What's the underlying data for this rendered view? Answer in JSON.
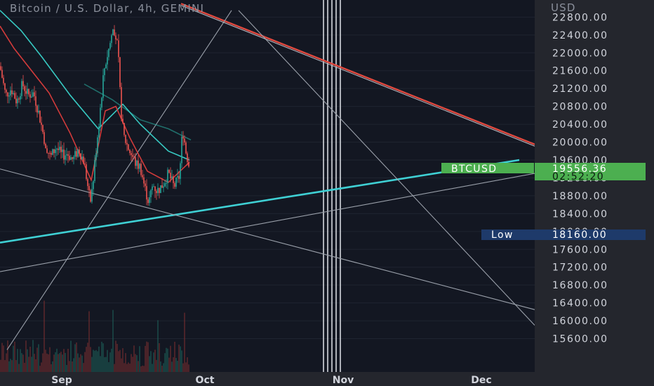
{
  "header": {
    "title": "Bitcoin / U.S. Dollar, 4h, GEMINI"
  },
  "axis": {
    "currency": "USD"
  },
  "colors": {
    "background": "#131722",
    "axis_bg": "#24262d",
    "grid": "#1f2430",
    "up": "#26a69a",
    "down": "#ef5350",
    "trend_red": "#e0493f",
    "trend_cyan": "#3fd0d4",
    "trend_grey": "#9aa0aa",
    "ma_slow": "#2aa89d",
    "ma_cyan": "#37c9c2",
    "ma_red": "#d33b3b",
    "tag_green": "#4caf50",
    "tag_navy": "#1e3a6a"
  },
  "tags": {
    "symbol": "BTCUSD",
    "last_price": "19556.36",
    "countdown": "02:52:20",
    "low_label": "Low",
    "low_value": "18160.00"
  },
  "chart_data": {
    "type": "candlestick",
    "title": "Bitcoin / U.S. Dollar, 4h, GEMINI",
    "y_label": "USD",
    "y_ticks": [
      15600,
      16000,
      16400,
      16800,
      17200,
      17600,
      18000,
      18400,
      18800,
      19200,
      19600,
      20000,
      20400,
      20800,
      21200,
      21600,
      22000,
      22400,
      22800
    ],
    "x_ticks": [
      "Sep",
      "Oct",
      "Nov",
      "Dec"
    ],
    "ylim": [
      15200,
      22900
    ],
    "last_price": 19556.36,
    "low": 18160.0,
    "grid": true,
    "series": [
      {
        "name": "",
        "kind": "price",
        "points": [
          [
            0,
            21700
          ],
          [
            8,
            21050
          ],
          [
            16,
            21200
          ],
          [
            24,
            20900
          ],
          [
            32,
            21300
          ],
          [
            40,
            21050
          ],
          [
            48,
            21100
          ],
          [
            56,
            20600
          ],
          [
            64,
            20000
          ],
          [
            72,
            19650
          ],
          [
            80,
            19900
          ],
          [
            88,
            19700
          ],
          [
            96,
            19750
          ],
          [
            104,
            19600
          ],
          [
            112,
            19850
          ],
          [
            120,
            19550
          ],
          [
            128,
            18700
          ],
          [
            132,
            19000
          ],
          [
            136,
            19700
          ],
          [
            142,
            20600
          ],
          [
            148,
            21600
          ],
          [
            156,
            22150
          ],
          [
            162,
            22600
          ],
          [
            168,
            22100
          ],
          [
            172,
            20800
          ],
          [
            176,
            20150
          ],
          [
            182,
            19900
          ],
          [
            188,
            19700
          ],
          [
            194,
            19500
          ],
          [
            200,
            19450
          ],
          [
            206,
            19000
          ],
          [
            212,
            18650
          ],
          [
            218,
            19050
          ],
          [
            224,
            18900
          ],
          [
            232,
            19050
          ],
          [
            240,
            19300
          ],
          [
            248,
            19000
          ],
          [
            256,
            19250
          ],
          [
            260,
            20300
          ],
          [
            264,
            19900
          ],
          [
            268,
            19556
          ]
        ]
      },
      {
        "name": "",
        "kind": "ma_slow",
        "points": [
          [
            120,
            21300
          ],
          [
            160,
            20950
          ],
          [
            200,
            20500
          ],
          [
            240,
            20300
          ],
          [
            272,
            20050
          ]
        ]
      },
      {
        "name": "",
        "kind": "ma_cyan",
        "points": [
          [
            0,
            22950
          ],
          [
            30,
            22500
          ],
          [
            60,
            21900
          ],
          [
            100,
            21050
          ],
          [
            140,
            20300
          ],
          [
            175,
            20850
          ],
          [
            200,
            20400
          ],
          [
            240,
            19800
          ],
          [
            270,
            19600
          ]
        ]
      },
      {
        "name": "",
        "kind": "ma_red",
        "points": [
          [
            0,
            22600
          ],
          [
            20,
            22100
          ],
          [
            40,
            21700
          ],
          [
            70,
            21100
          ],
          [
            100,
            20200
          ],
          [
            130,
            19150
          ],
          [
            150,
            20700
          ],
          [
            165,
            20800
          ],
          [
            185,
            20100
          ],
          [
            210,
            19350
          ],
          [
            240,
            19100
          ],
          [
            270,
            19550
          ]
        ]
      }
    ],
    "trendlines": [
      {
        "kind": "red",
        "start": [
          258,
          23100
        ],
        "end": [
          762,
          19950
        ]
      },
      {
        "kind": "cyan",
        "start": [
          0,
          17750
        ],
        "end": [
          740,
          19600
        ]
      },
      {
        "kind": "grey",
        "start": [
          0,
          19400
        ],
        "end": [
          762,
          16250
        ]
      },
      {
        "kind": "grey",
        "start": [
          0,
          17100
        ],
        "end": [
          762,
          19300
        ]
      },
      {
        "kind": "grey",
        "start": [
          10,
          15350
        ],
        "end": [
          330,
          22950
        ]
      },
      {
        "kind": "grey",
        "start": [
          340,
          22950
        ],
        "end": [
          762,
          15900
        ]
      }
    ],
    "vertical_lines": [
      461,
      467,
      473,
      479,
      485
    ]
  }
}
